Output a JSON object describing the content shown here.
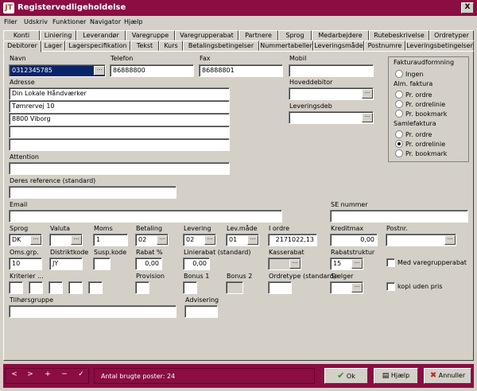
{
  "window": {
    "title": "Registervedligeholdelse",
    "close": "X",
    "app_icon": "JT"
  },
  "menu": [
    "Filer",
    "Udskriv",
    "Funktioner",
    "Navigator",
    "Hjælp"
  ],
  "tabs_top": [
    "Konti",
    "Liniering",
    "Leverandør",
    "Varegruppe",
    "Varegrupperabat",
    "Partnere",
    "Sprog",
    "Medarbejdere",
    "Rutebeskrivelse",
    "Ordretyper"
  ],
  "tabs_bottom": [
    "Debitorer",
    "Lager",
    "Lagerspecifikation",
    "Tekst",
    "Kurs",
    "Betalingsbetingelser",
    "Nummertabeller",
    "Leveringsmåde",
    "Postnumre",
    "Leveringsbetingelser"
  ],
  "form": {
    "navn": {
      "label": "Navn",
      "value": "0312345785"
    },
    "telefon": {
      "label": "Telefon",
      "value": "86888800"
    },
    "fax": {
      "label": "Fax",
      "value": "86888801"
    },
    "mobil": {
      "label": "Mobil",
      "value": ""
    },
    "adresse": {
      "label": "Adresse",
      "lines": [
        "Din Lokale Håndværker",
        "Tømrervej 10",
        "8800 Viborg",
        "",
        ""
      ]
    },
    "hoveddebitor": {
      "label": "Hoveddebitor",
      "value": ""
    },
    "leveringsdeb": {
      "label": "Leveringsdeb",
      "value": ""
    },
    "attention": {
      "label": "Attention",
      "value": ""
    },
    "deres_ref": {
      "label": "Deres reference (standard)",
      "value": ""
    },
    "email": {
      "label": "Email",
      "value": ""
    },
    "se_nummer": {
      "label": "SE nummer",
      "value": ""
    },
    "sprog": {
      "label": "Sprog",
      "value": "DK"
    },
    "valuta": {
      "label": "Valuta",
      "value": ""
    },
    "moms": {
      "label": "Moms",
      "value": "1"
    },
    "betaling": {
      "label": "Betaling",
      "value": "02"
    },
    "levering": {
      "label": "Levering",
      "value": "02"
    },
    "levmade": {
      "label": "Lev.måde",
      "value": "01"
    },
    "iordre": {
      "label": "I ordre",
      "value": "2171022,13"
    },
    "kreditmax": {
      "label": "Kreditmax",
      "value": "0,00"
    },
    "postnr": {
      "label": "Postnr.",
      "value": ""
    },
    "omsgrp": {
      "label": "Oms.grp.",
      "value": "10"
    },
    "distriktkode": {
      "label": "Distriktkode",
      "value": "JY"
    },
    "susp": {
      "label": "Susp.kode",
      "value": ""
    },
    "rabat": {
      "label": "Rabat %",
      "value": "0,00"
    },
    "linierabat": {
      "label": "Linierabat (standard)",
      "value": "0,00"
    },
    "kasserabat": {
      "label": "Kasserabat",
      "value": ""
    },
    "rabatstruktur": {
      "label": "Rabatstruktur",
      "value": "15"
    },
    "med_vgr": {
      "label": "Med varegrupperabat"
    },
    "kriterier": {
      "label": "Kriterier ..."
    },
    "provision": {
      "label": "Provision"
    },
    "bonus1": {
      "label": "Bonus 1"
    },
    "bonus2": {
      "label": "Bonus 2"
    },
    "ordretype": {
      "label": "Ordretype (standard)"
    },
    "saelger": {
      "label": "Sælger"
    },
    "kopi": {
      "label": "kopi uden pris"
    },
    "tilhorsgruppe": {
      "label": "Tilhørsgruppe",
      "value": ""
    },
    "advisering": {
      "label": "Advisering",
      "value": ""
    }
  },
  "faktura": {
    "title": "Fakturaudformning",
    "ingen": "Ingen",
    "alm": "Alm. faktura",
    "pr_ordre": "Pr. ordre",
    "pr_ordrelinie": "Pr. ordrelinie",
    "pr_bookmark": "Pr. bookmark",
    "samle": "Samlefaktura",
    "selected": "samle-pr-ordrelinie"
  },
  "bottom": {
    "nav": [
      "<",
      ">",
      "+",
      "−",
      "✓"
    ],
    "count": "Antal brugte poster: 24",
    "ok": "Ok",
    "help": "Hjælp",
    "cancel": "Annuller"
  },
  "colors": {
    "titlebar": "#8b0d42",
    "face": "#d4d0c8"
  }
}
